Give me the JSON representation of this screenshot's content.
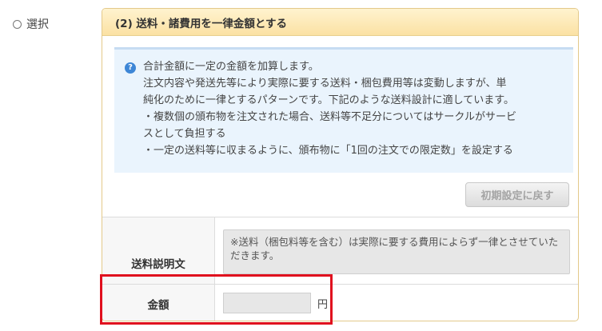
{
  "option": {
    "label": "選択"
  },
  "panel": {
    "title": "(2) 送料・諸費用を一律金額とする",
    "info_lines": [
      "合計金額に一定の金額を加算します。",
      "注文内容や発送先等により実際に要する送料・梱包費用等は変動しますが、単",
      "純化のために一律とするパターンです。下記のような送料設計に適しています。",
      "・複数個の頒布物を注文された場合、送料等不足分についてはサークルがサービ",
      "スとして負担する",
      "・一定の送料等に収まるように、頒布物に「1回の注文での限定数」を設定する"
    ],
    "reset_button": "初期設定に戻す"
  },
  "form": {
    "desc_label": "送料説明文",
    "desc_value": "※送料（梱包料等を含む）は実際に要する費用によらず一律とさせていただきます。",
    "amount_label": "金額",
    "amount_value": "",
    "amount_unit": "円"
  }
}
